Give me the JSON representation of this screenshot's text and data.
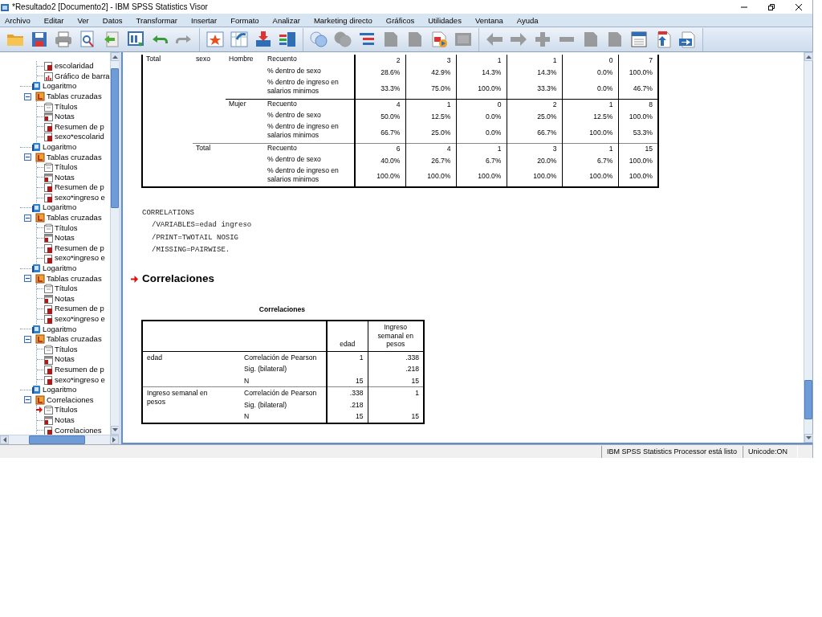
{
  "window": {
    "title": "*Resultado2 [Documento2] - IBM SPSS Statistics Visor"
  },
  "menu": [
    "Archivo",
    "Editar",
    "Ver",
    "Datos",
    "Transformar",
    "Insertar",
    "Formato",
    "Analizar",
    "Marketing directo",
    "Gráficos",
    "Utilidades",
    "Ventana",
    "Ayuda"
  ],
  "toolbar": [
    {
      "disabled": false
    },
    {
      "disabled": false
    },
    {
      "disabled": false
    },
    {
      "disabled": false
    },
    {
      "disabled": false
    },
    {
      "disabled": false
    },
    {
      "disabled": false
    },
    {
      "disabled": true
    },
    {
      "disabled": false
    },
    {
      "disabled": false
    },
    {
      "disabled": false
    },
    {
      "disabled": false
    },
    {
      "disabled": false
    },
    {
      "disabled": true
    },
    {
      "disabled": false
    },
    {
      "disabled": true
    },
    {
      "disabled": true
    },
    {
      "disabled": false
    },
    {
      "disabled": true
    },
    {
      "disabled": true
    },
    {
      "disabled": true
    },
    {
      "disabled": true
    },
    {
      "disabled": true
    },
    {
      "disabled": true
    },
    {
      "disabled": true
    },
    {
      "disabled": false
    },
    {
      "disabled": false
    },
    {
      "disabled": false
    }
  ],
  "outline": {
    "items": [
      {
        "kind": "hidden",
        "children": [
          {
            "kind": "table",
            "label": "escolaridad",
            "current": false
          },
          {
            "kind": "chart",
            "label": "Gráfico de barra",
            "current": false
          }
        ]
      },
      {
        "kind": "log",
        "label": "Logaritmo"
      },
      {
        "kind": "procedure",
        "label": "Tablas cruzadas",
        "expanded": true,
        "children": [
          {
            "kind": "title",
            "label": "Títulos",
            "current": false
          },
          {
            "kind": "notes",
            "label": "Notas",
            "current": false
          },
          {
            "kind": "table",
            "label": "Resumen de p",
            "current": false
          },
          {
            "kind": "table",
            "label": "sexo*escolarid",
            "current": false
          }
        ]
      },
      {
        "kind": "log",
        "label": "Logaritmo"
      },
      {
        "kind": "procedure",
        "label": "Tablas cruzadas",
        "expanded": true,
        "children": [
          {
            "kind": "title",
            "label": "Títulos",
            "current": false
          },
          {
            "kind": "notes",
            "label": "Notas",
            "current": false
          },
          {
            "kind": "table",
            "label": "Resumen de p",
            "current": false
          },
          {
            "kind": "table",
            "label": "sexo*ingreso e",
            "current": false
          }
        ]
      },
      {
        "kind": "log",
        "label": "Logaritmo"
      },
      {
        "kind": "procedure",
        "label": "Tablas cruzadas",
        "expanded": true,
        "children": [
          {
            "kind": "title",
            "label": "Títulos",
            "current": false
          },
          {
            "kind": "notes",
            "label": "Notas",
            "current": false
          },
          {
            "kind": "table",
            "label": "Resumen de p",
            "current": false
          },
          {
            "kind": "table",
            "label": "sexo*ingreso e",
            "current": false
          }
        ]
      },
      {
        "kind": "log",
        "label": "Logaritmo"
      },
      {
        "kind": "procedure",
        "label": "Tablas cruzadas",
        "expanded": true,
        "children": [
          {
            "kind": "title",
            "label": "Títulos",
            "current": false
          },
          {
            "kind": "notes",
            "label": "Notas",
            "current": false
          },
          {
            "kind": "table",
            "label": "Resumen de p",
            "current": false
          },
          {
            "kind": "table",
            "label": "sexo*ingreso e",
            "current": false
          }
        ]
      },
      {
        "kind": "log",
        "label": "Logaritmo"
      },
      {
        "kind": "procedure",
        "label": "Tablas cruzadas",
        "expanded": true,
        "children": [
          {
            "kind": "title",
            "label": "Títulos",
            "current": false
          },
          {
            "kind": "notes",
            "label": "Notas",
            "current": false
          },
          {
            "kind": "table",
            "label": "Resumen de p",
            "current": false
          },
          {
            "kind": "table",
            "label": "sexo*ingreso e",
            "current": false
          }
        ]
      },
      {
        "kind": "log",
        "label": "Logaritmo"
      },
      {
        "kind": "procedure",
        "label": "Correlaciones",
        "expanded": true,
        "children": [
          {
            "kind": "title",
            "label": "Títulos",
            "current": true
          },
          {
            "kind": "notes",
            "label": "Notas",
            "current": false
          },
          {
            "kind": "table",
            "label": "Correlaciones",
            "current": false
          }
        ]
      }
    ]
  },
  "crosstab": {
    "label": "Total",
    "variable": "sexo",
    "groups": [
      {
        "label": "Hombre",
        "rows": [
          {
            "label": "Recuento",
            "values": [
              "2",
              "3",
              "1",
              "1",
              "0",
              "7"
            ]
          },
          {
            "label": "% dentro de sexo",
            "values": [
              "28.6%",
              "42.9%",
              "14.3%",
              "14.3%",
              "0.0%",
              "100.0%"
            ]
          },
          {
            "label": "% dentro de ingreso en salarios minimos",
            "values": [
              "33.3%",
              "75.0%",
              "100.0%",
              "33.3%",
              "0.0%",
              "46.7%"
            ]
          }
        ]
      },
      {
        "label": "Mujer",
        "rows": [
          {
            "label": "Recuento",
            "values": [
              "4",
              "1",
              "0",
              "2",
              "1",
              "8"
            ]
          },
          {
            "label": "% dentro de sexo",
            "values": [
              "50.0%",
              "12.5%",
              "0.0%",
              "25.0%",
              "12.5%",
              "100.0%"
            ]
          },
          {
            "label": "% dentro de ingreso en salarios minimos",
            "values": [
              "66.7%",
              "25.0%",
              "0.0%",
              "66.7%",
              "100.0%",
              "53.3%"
            ]
          }
        ]
      },
      {
        "label": "Total",
        "kind": "total",
        "rows": [
          {
            "label": "Recuento",
            "values": [
              "6",
              "4",
              "1",
              "3",
              "1",
              "15"
            ]
          },
          {
            "label": "% dentro de sexo",
            "values": [
              "40.0%",
              "26.7%",
              "6.7%",
              "20.0%",
              "6.7%",
              "100.0%"
            ]
          },
          {
            "label": "% dentro de ingreso en salarios minimos",
            "values": [
              "100.0%",
              "100.0%",
              "100.0%",
              "100.0%",
              "100.0%",
              "100.0%"
            ]
          }
        ]
      }
    ]
  },
  "syntax": [
    "CORRELATIONS",
    "/VARIABLES=edad ingreso",
    "/PRINT=TWOTAIL NOSIG",
    "/MISSING=PAIRWISE."
  ],
  "heading": "Correlaciones",
  "correlations": {
    "title": "Correlaciones",
    "columns": [
      "edad",
      "Ingreso semanal en pesos"
    ],
    "groups": [
      {
        "label": "edad",
        "rows": [
          {
            "label": "Correlación de Pearson",
            "value_1": "1",
            "value_2": ".338"
          },
          {
            "label": "Sig. (bilateral)",
            "value_2": ".218"
          },
          {
            "label": "N",
            "value_1": "15",
            "value_2": "15"
          }
        ]
      },
      {
        "label": "Ingreso semanal en pesos",
        "rows": [
          {
            "label": "Correlación de Pearson",
            "value_1": ".338",
            "value_2": "1"
          },
          {
            "label": "Sig. (bilateral)",
            "value_1": ".218"
          },
          {
            "label": "N",
            "value_1": "15",
            "value_2": "15"
          }
        ]
      }
    ]
  },
  "status_bar": {
    "message": "IBM SPSS Statistics Processor está listo",
    "encoding": "Unicode:ON"
  }
}
